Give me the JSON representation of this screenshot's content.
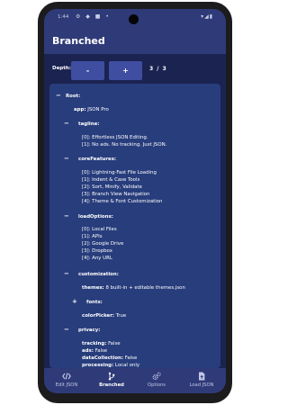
{
  "status": {
    "time": "1:44",
    "left_icons": "⚙ ◆ ■ •",
    "right_icons": "▾◢▮"
  },
  "appbar": {
    "title": "Branched"
  },
  "depth": {
    "label": "Depth:",
    "minus": "-",
    "plus": "+",
    "value": "3 / 3"
  },
  "tree": {
    "root_key": "Root:",
    "app_key": "app:",
    "app_value": "JSON Pro",
    "tagline_key": "tagline:",
    "tagline": [
      "[0]: Effortless JSON Editing.",
      "[1]: No ads. No tracking. Just JSON."
    ],
    "core_key": "coreFeatures:",
    "core": [
      "[0]: Lightning-Fast File Loading",
      "[1]: Indent & Case Tools",
      "[2]: Sort, Minify, Validate",
      "[3]: Branch View Navigation",
      "[4]: Theme & Font Customization"
    ],
    "load_key": "loadOptions:",
    "load": [
      "[0]: Local Files",
      "[1]: APIs",
      "[2]: Google Drive",
      "[3]: Dropbox",
      "[4]: Any URL"
    ],
    "custom_key": "customization:",
    "themes_key": "themes:",
    "themes_value": "8 built-in + editable themes.json",
    "fonts_key": "fonts:",
    "picker_key": "colorPicker:",
    "picker_value": "True",
    "privacy_key": "privacy:",
    "privacy": [
      {
        "k": "tracking:",
        "v": "False"
      },
      {
        "k": "ads:",
        "v": "False"
      },
      {
        "k": "dataCollection:",
        "v": "False"
      },
      {
        "k": "processing:",
        "v": "Local only"
      }
    ],
    "collapse": "−",
    "expand": "+"
  },
  "nav": [
    {
      "label": "Edit JSON",
      "icon": "code-icon"
    },
    {
      "label": "Branched",
      "icon": "branch-icon"
    },
    {
      "label": "Options",
      "icon": "gears-icon"
    },
    {
      "label": "Load JSON",
      "icon": "file-upload-icon"
    }
  ],
  "colors": {
    "accent": "#3f4ea1",
    "appbar": "#2f3a78",
    "background": "#1b2351",
    "card": "#283d7c"
  }
}
